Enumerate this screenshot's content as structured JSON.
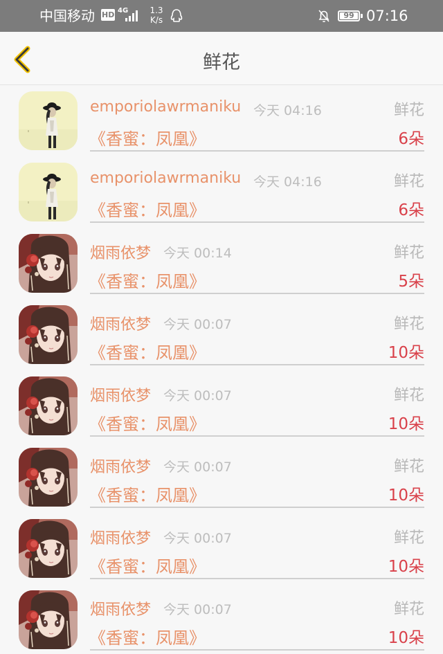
{
  "status_bar": {
    "carrier": "中国移动",
    "hd": "HD",
    "network": "4G",
    "speed_value": "1.3",
    "speed_unit": "K/s",
    "battery": "99",
    "battery_level": 0.99,
    "time": "07:16"
  },
  "header": {
    "title": "鲜花",
    "accent_color": "#f2c200"
  },
  "colors": {
    "name": "#e8926a",
    "count": "#d9414a",
    "muted": "#bdbdbd"
  },
  "gifts": [
    {
      "avatar": "silhouette-avatar",
      "name": "emporiolawrmaniku",
      "time": "今天 04:16",
      "type": "鲜花",
      "song": "《香蜜：凤凰》",
      "count": "6朵"
    },
    {
      "avatar": "silhouette-avatar",
      "name": "emporiolawrmaniku",
      "time": "今天 04:16",
      "type": "鲜花",
      "song": "《香蜜：凤凰》",
      "count": "6朵"
    },
    {
      "avatar": "anime-girl-avatar",
      "name": "烟雨依梦",
      "time": "今天 00:14",
      "type": "鲜花",
      "song": "《香蜜：凤凰》",
      "count": "5朵"
    },
    {
      "avatar": "anime-girl-avatar",
      "name": "烟雨依梦",
      "time": "今天 00:07",
      "type": "鲜花",
      "song": "《香蜜：凤凰》",
      "count": "10朵"
    },
    {
      "avatar": "anime-girl-avatar",
      "name": "烟雨依梦",
      "time": "今天 00:07",
      "type": "鲜花",
      "song": "《香蜜：凤凰》",
      "count": "10朵"
    },
    {
      "avatar": "anime-girl-avatar",
      "name": "烟雨依梦",
      "time": "今天 00:07",
      "type": "鲜花",
      "song": "《香蜜：凤凰》",
      "count": "10朵"
    },
    {
      "avatar": "anime-girl-avatar",
      "name": "烟雨依梦",
      "time": "今天 00:07",
      "type": "鲜花",
      "song": "《香蜜：凤凰》",
      "count": "10朵"
    },
    {
      "avatar": "anime-girl-avatar",
      "name": "烟雨依梦",
      "time": "今天 00:07",
      "type": "鲜花",
      "song": "《香蜜：凤凰》",
      "count": "10朵"
    }
  ]
}
